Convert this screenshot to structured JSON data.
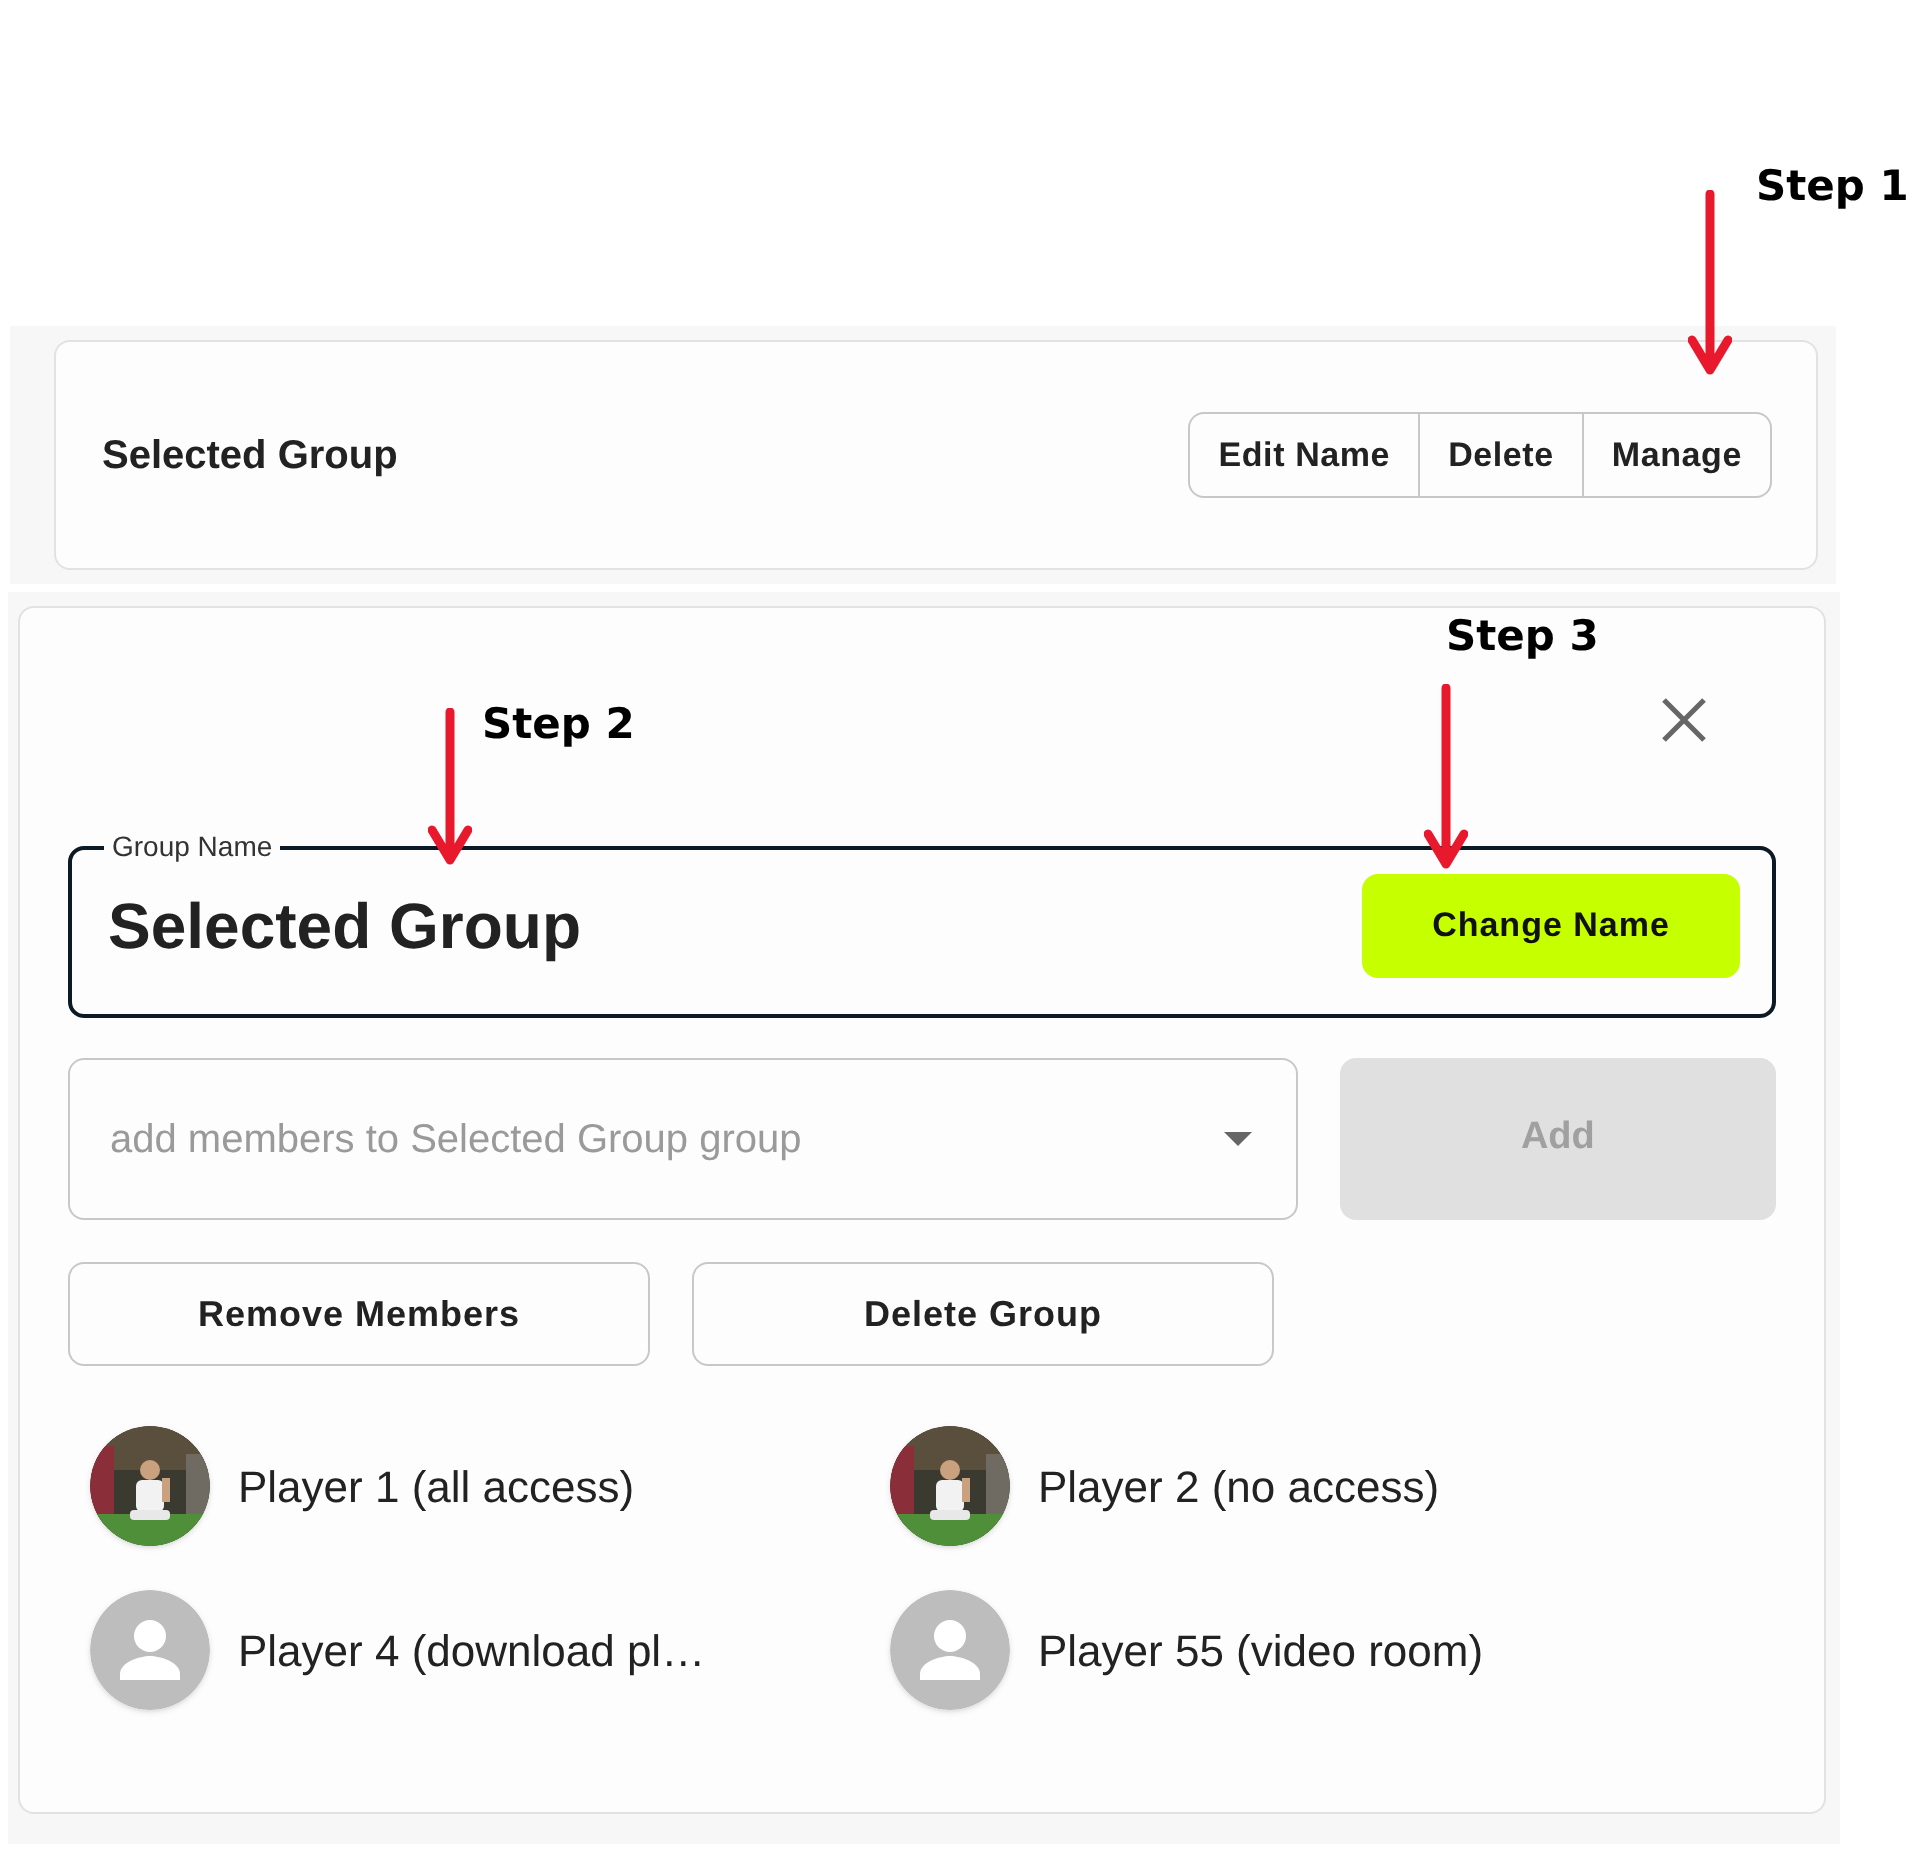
{
  "annotations": [
    {
      "label": "Step 1"
    },
    {
      "label": "Step 2"
    },
    {
      "label": "Step 3"
    }
  ],
  "group_header": {
    "title": "Selected Group",
    "actions": [
      "Edit Name",
      "Delete",
      "Manage"
    ]
  },
  "manage_dialog": {
    "name_field": {
      "label": "Group Name",
      "value": "Selected Group",
      "button": "Change Name"
    },
    "member_select": {
      "placeholder": "add members to Selected Group group"
    },
    "add_button": {
      "label": "Add",
      "disabled": true
    },
    "buttons": [
      "Remove Members",
      "Delete Group"
    ],
    "members": [
      {
        "name": "Player 1 (all access)"
      },
      {
        "name": "Player 2 (no access)"
      },
      {
        "name": "Player 4 (download pl…",
        "kind": "placeholder"
      },
      {
        "name": "Player 55 (video room)",
        "kind": "placeholder"
      }
    ]
  }
}
